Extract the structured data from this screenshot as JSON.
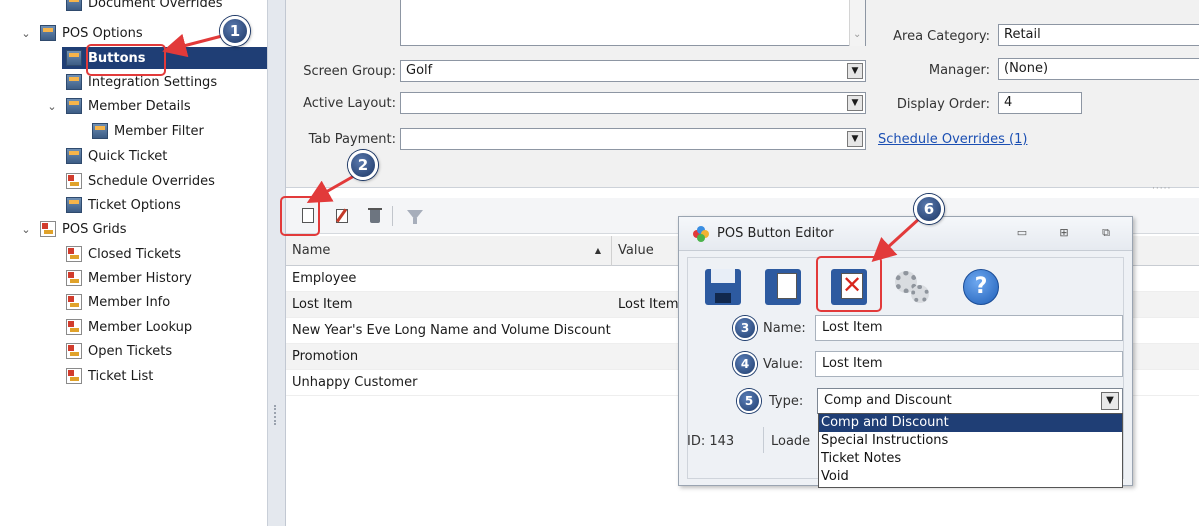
{
  "tree": {
    "items": [
      {
        "label": "Document Overrides",
        "level": 2,
        "icon": "options"
      },
      {
        "label": "POS Options",
        "level": 1,
        "icon": "options",
        "expanded": true
      },
      {
        "label": "Buttons",
        "level": 2,
        "icon": "options",
        "selected": true
      },
      {
        "label": "Integration Settings",
        "level": 2,
        "icon": "options"
      },
      {
        "label": "Member Details",
        "level": 2,
        "icon": "options",
        "expanded": true
      },
      {
        "label": "Member Filter",
        "level": 3,
        "icon": "options"
      },
      {
        "label": "Quick Ticket",
        "level": 2,
        "icon": "options"
      },
      {
        "label": "Schedule Overrides",
        "level": 2,
        "icon": "grid"
      },
      {
        "label": "Ticket Options",
        "level": 2,
        "icon": "options"
      },
      {
        "label": "POS Grids",
        "level": 1,
        "icon": "grid",
        "expanded": true
      },
      {
        "label": "Closed Tickets",
        "level": 2,
        "icon": "grid"
      },
      {
        "label": "Member History",
        "level": 2,
        "icon": "grid"
      },
      {
        "label": "Member Info",
        "level": 2,
        "icon": "grid"
      },
      {
        "label": "Member Lookup",
        "level": 2,
        "icon": "grid"
      },
      {
        "label": "Open Tickets",
        "level": 2,
        "icon": "grid"
      },
      {
        "label": "Ticket List",
        "level": 2,
        "icon": "grid"
      }
    ]
  },
  "form": {
    "screen_group_label": "Screen Group:",
    "screen_group_value": "Golf",
    "active_layout_label": "Active Layout:",
    "active_layout_value": "",
    "tab_payment_label": "Tab Payment:",
    "tab_payment_value": "",
    "area_category_label": "Area Category:",
    "area_category_value": "Retail",
    "manager_label": "Manager:",
    "manager_value": "(None)",
    "display_order_label": "Display Order:",
    "display_order_value": "4",
    "schedule_overrides_link": "Schedule Overrides (1)"
  },
  "grid": {
    "columns": [
      "Name",
      "Value"
    ],
    "sort_indicator": "▲",
    "rows": [
      {
        "name": "Employee",
        "value": ""
      },
      {
        "name": "Lost Item",
        "value": "Lost Item"
      },
      {
        "name": "New Year's Eve Long Name and Volume Discount",
        "value": ""
      },
      {
        "name": "Promotion",
        "value": ""
      },
      {
        "name": "Unhappy Customer",
        "value": ""
      }
    ]
  },
  "dialog": {
    "title": "POS Button Editor",
    "name_label": "Name:",
    "name_value": "Lost Item",
    "value_label": "Value:",
    "value_value": "Lost Item",
    "type_label": "Type:",
    "type_value": "Comp and Discount",
    "type_options": [
      "Comp and Discount",
      "Special Instructions",
      "Ticket Notes",
      "Void"
    ],
    "footer_id": "ID: 143",
    "footer_loaded": "Loade"
  },
  "callouts": [
    "1",
    "2",
    "3",
    "4",
    "5",
    "6"
  ],
  "colors": {
    "selection": "#1f3e75",
    "link": "#1b4fb3",
    "annotation_red": "#e23a3a",
    "callout_blue": "#1c3766"
  }
}
